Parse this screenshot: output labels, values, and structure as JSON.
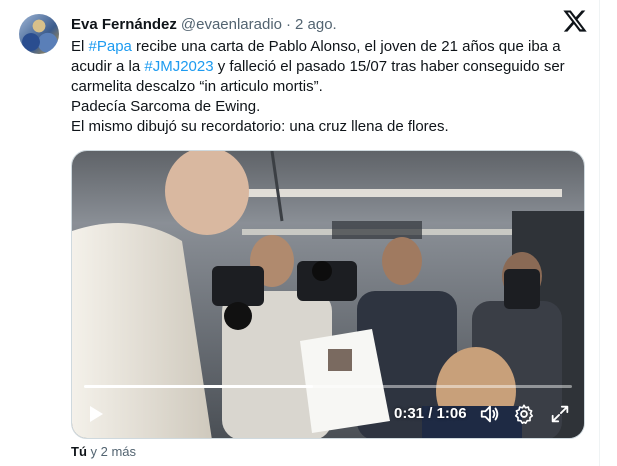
{
  "author": {
    "name": "Eva Fernández",
    "handle": "@evaenlaradio",
    "separator": "·",
    "date": "2 ago."
  },
  "tweet": {
    "line1_pre": "El ",
    "hashtag1": "#Papa",
    "line1_post": " recibe una carta de Pablo Alonso, el joven de 21 años que iba a acudir a la ",
    "hashtag2": "#JMJ2023",
    "line2_post": " y falleció el pasado 15/07 tras haber conseguido ser carmelita descalzo “in articulo mortis”.",
    "line4": "Padecía Sarcoma de Ewing.",
    "line5": "El mismo dibujó su recordatorio: una  cruz llena de flores."
  },
  "video": {
    "time": "0:31 / 1:06",
    "progress": 0.47
  },
  "footer": {
    "who": "Tú",
    "rest": " y 2 más"
  },
  "icons": {
    "logo": "x-logo-icon",
    "play": "play-icon",
    "volume": "volume-icon",
    "settings": "gear-icon",
    "fullscreen": "fullscreen-icon"
  },
  "colors": {
    "link": "#1d9bf0",
    "text": "#0f1419",
    "muted": "#536471"
  }
}
